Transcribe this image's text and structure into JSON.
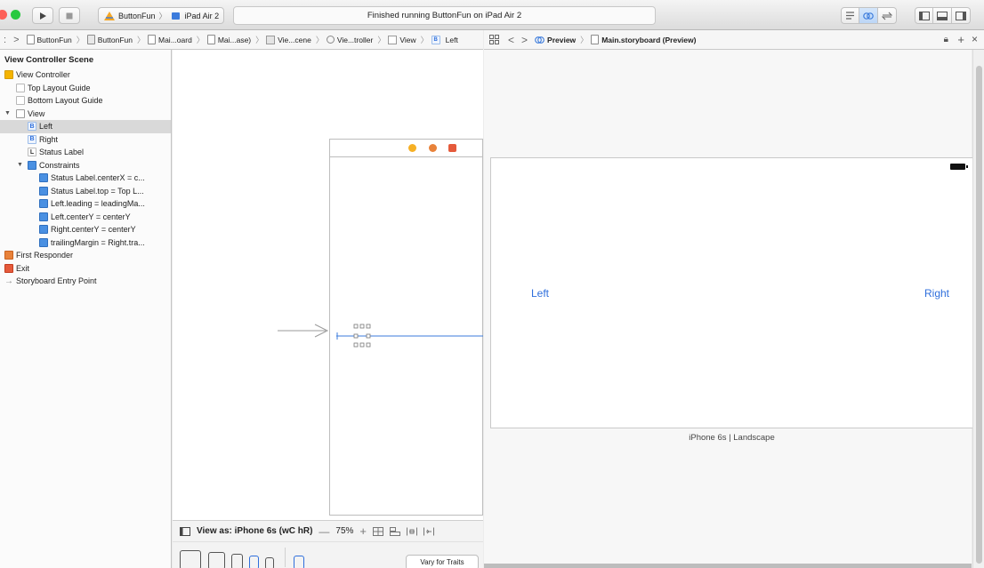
{
  "toolbar": {
    "scheme_target": "ButtonFun",
    "scheme_device": "iPad Air 2",
    "activity_status": "Finished running ButtonFun on iPad Air 2",
    "colors": {
      "close": "#fd5f57",
      "minimize": "#28c940",
      "accent": "#2f6fdc"
    }
  },
  "jumpbar_left": {
    "crumbs": [
      "ButtonFun",
      "ButtonFun",
      "Mai...oard",
      "Mai...ase)",
      "Vie...cene",
      "Vie...troller",
      "View",
      "Left"
    ]
  },
  "jumpbar_right": {
    "preview_label": "Preview",
    "file_label": "Main.storyboard (Preview)"
  },
  "outline": {
    "title": "View Controller Scene",
    "items": [
      {
        "label": "View Controller",
        "icon": "view-controller-icon"
      },
      {
        "label": "Top Layout Guide",
        "icon": "layout-guide-icon"
      },
      {
        "label": "Bottom Layout Guide",
        "icon": "layout-guide-icon"
      },
      {
        "label": "View",
        "icon": "view-icon"
      },
      {
        "label": "Left",
        "icon": "button-icon",
        "glyph": "B"
      },
      {
        "label": "Right",
        "icon": "button-icon",
        "glyph": "B"
      },
      {
        "label": "Status Label",
        "icon": "label-icon",
        "glyph": "L"
      },
      {
        "label": "Constraints",
        "icon": "constraints-icon"
      },
      {
        "label": "Status Label.centerX = c...",
        "icon": "constraint-icon"
      },
      {
        "label": "Status Label.top = Top L...",
        "icon": "constraint-icon"
      },
      {
        "label": "Left.leading = leadingMa...",
        "icon": "constraint-icon"
      },
      {
        "label": "Left.centerY = centerY",
        "icon": "constraint-icon"
      },
      {
        "label": "Right.centerY = centerY",
        "icon": "constraint-icon"
      },
      {
        "label": "trailingMargin = Right.tra...",
        "icon": "constraint-icon"
      },
      {
        "label": "First Responder",
        "icon": "first-responder-icon"
      },
      {
        "label": "Exit",
        "icon": "exit-icon"
      },
      {
        "label": "Storyboard Entry Point",
        "icon": "entry-arrow-icon"
      }
    ],
    "selected": "Left"
  },
  "canvas": {
    "view_as": "View as: iPhone 6s (wC hR)",
    "zoom": "75%",
    "vary_button": "Vary for Traits"
  },
  "preview": {
    "left_button": "Left",
    "right_button": "Right",
    "caption": "iPhone 6s | Landscape"
  }
}
